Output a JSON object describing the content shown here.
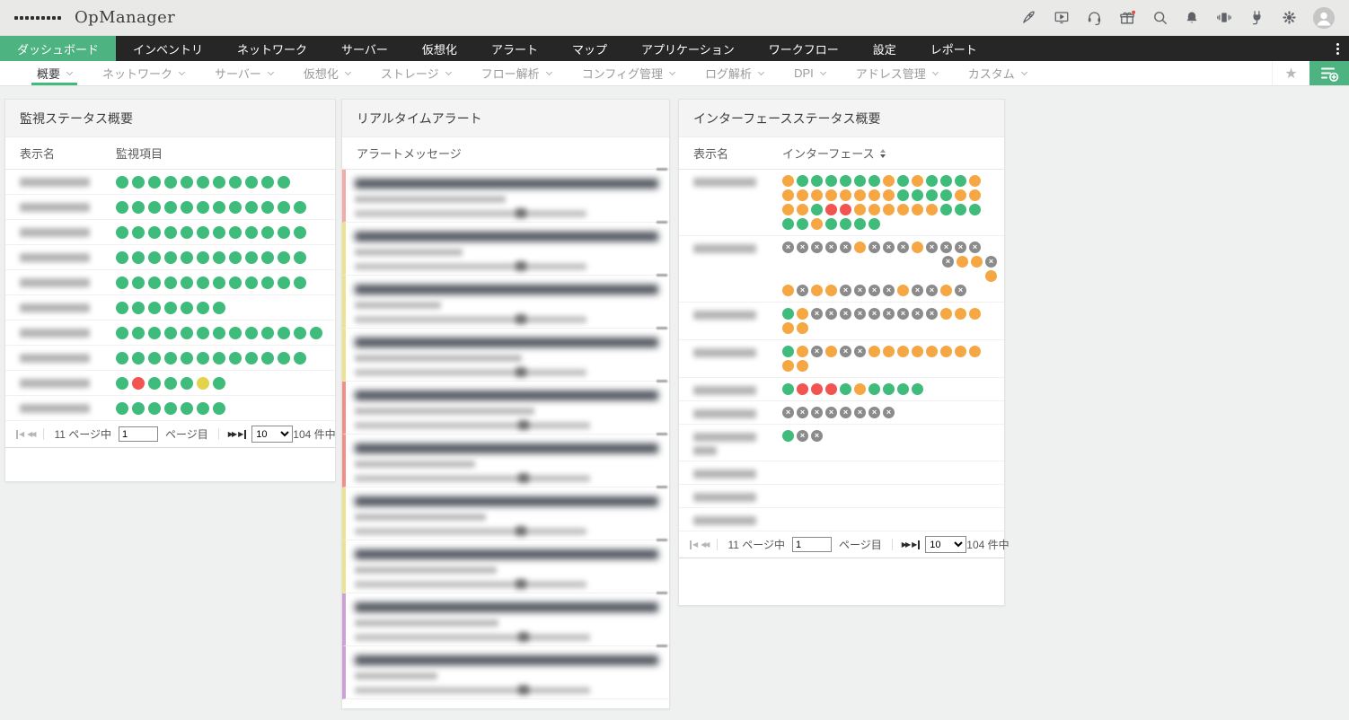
{
  "header": {
    "app_title": "OpManager",
    "icons": [
      "apps-grid-icon",
      "rocket-icon",
      "demo-video-icon",
      "support-headset-icon",
      "gift-icon",
      "search-icon",
      "notifications-bell-icon",
      "mobile-vibrate-icon",
      "plugin-icon",
      "settings-gear-icon",
      "user-avatar"
    ]
  },
  "nav": {
    "items": [
      {
        "label": "ダッシュボード",
        "active": true
      },
      {
        "label": "インベントリ"
      },
      {
        "label": "ネットワーク"
      },
      {
        "label": "サーバー"
      },
      {
        "label": "仮想化"
      },
      {
        "label": "アラート"
      },
      {
        "label": "マップ"
      },
      {
        "label": "アプリケーション"
      },
      {
        "label": "ワークフロー"
      },
      {
        "label": "設定"
      },
      {
        "label": "レポート"
      }
    ]
  },
  "subnav": {
    "items": [
      {
        "label": "概要",
        "active": true
      },
      {
        "label": "ネットワーク"
      },
      {
        "label": "サーバー"
      },
      {
        "label": "仮想化"
      },
      {
        "label": "ストレージ"
      },
      {
        "label": "フロー解析"
      },
      {
        "label": "コンフィグ管理"
      },
      {
        "label": "ログ解析"
      },
      {
        "label": "DPI"
      },
      {
        "label": "アドレス管理"
      },
      {
        "label": "カスタム"
      }
    ]
  },
  "pagination": {
    "pages_label": "11 ページ中",
    "page": "1",
    "page_suffix": "ページ目",
    "page_size": "10",
    "total_label": "104 件中"
  },
  "colors": {
    "status_green": "#3fbb7b",
    "status_orange": "#f4a742",
    "status_red": "#f25451",
    "status_yellow": "#e3d24c",
    "status_gray": "#8b8b8b",
    "accent_green": "#4db381"
  },
  "panels": {
    "monitor": {
      "title": "監視ステータス概要",
      "columns": [
        "表示名",
        "監視項目"
      ],
      "rows": [
        {
          "dots": "GGGGGGGGGGG"
        },
        {
          "dots": "GGGGGGGGGGGG"
        },
        {
          "dots": "GGGGGGGGGGGG"
        },
        {
          "dots": "GGGGGGGGGGGG"
        },
        {
          "dots": "GGGGGGGGGGGG"
        },
        {
          "dots": "GGGGGGG"
        },
        {
          "dots": "GGGGGGGGGGGGG"
        },
        {
          "dots": "GGGGGGGGGGGG"
        },
        {
          "dots": "GRGGGYG"
        },
        {
          "dots": "GGGGGGG"
        }
      ]
    },
    "alerts": {
      "title": "リアルタイムアラート",
      "column": "アラートメッセージ",
      "items": [
        {
          "severity_color": "#f2aba6",
          "title_w": 648,
          "l2_w": 168,
          "l3_w": 258
        },
        {
          "severity_color": "#ebe390",
          "title_w": 654,
          "l2_w": 120,
          "l3_w": 258
        },
        {
          "severity_color": "#ebe390",
          "title_w": 650,
          "l2_w": 96,
          "l3_w": 258
        },
        {
          "severity_color": "#ebe390",
          "title_w": 654,
          "l2_w": 186,
          "l3_w": 258
        },
        {
          "severity_color": "#f28f8a",
          "title_w": 640,
          "l2_w": 200,
          "l3_w": 262
        },
        {
          "severity_color": "#f28f8a",
          "title_w": 640,
          "l2_w": 134,
          "l3_w": 262
        },
        {
          "severity_color": "#ebe390",
          "title_w": 650,
          "l2_w": 146,
          "l3_w": 258
        },
        {
          "severity_color": "#ebe390",
          "title_w": 642,
          "l2_w": 158,
          "l3_w": 258
        },
        {
          "severity_color": "#cf9fd9",
          "title_w": 654,
          "l2_w": 160,
          "l3_w": 262
        },
        {
          "severity_color": "#cf9fd9",
          "title_w": 640,
          "l2_w": 92,
          "l3_w": 262
        }
      ]
    },
    "interfaces": {
      "title": "インターフェースステータス概要",
      "columns": [
        "表示名",
        "インターフェース"
      ],
      "rows": [
        {
          "lines": [
            {
              "dots": "OGGGGGGOGOGGGO"
            },
            {
              "dots": "OOOOOOOOGGGGOO"
            },
            {
              "dots": "OOGRROOOOOOGGG"
            },
            {
              "dots": "GGOGGGG"
            }
          ]
        },
        {
          "lines": [
            {
              "dots": "XXXXXOXXXOXXXX"
            },
            {
              "dots": "XOOX",
              "align": "right"
            },
            {
              "dots": "O",
              "align": "right"
            },
            {
              "dots": "OXOOXXXXOXXOX"
            }
          ]
        },
        {
          "lines": [
            {
              "dots": "GOXXXXXXXXXOOO"
            },
            {
              "dots": "OO"
            }
          ]
        },
        {
          "lines": [
            {
              "dots": "GOXOXXOOOOOOOO"
            },
            {
              "dots": "OO"
            }
          ]
        },
        {
          "lines": [
            {
              "dots": "GRRRGOGGGG"
            }
          ]
        },
        {
          "lines": [
            {
              "dots": "XXXXXXXX"
            }
          ]
        },
        {
          "label_lines": 2,
          "lines": [
            {
              "dots": "GXX"
            }
          ]
        },
        {
          "lines": []
        },
        {
          "lines": []
        },
        {
          "lines": []
        }
      ]
    }
  }
}
